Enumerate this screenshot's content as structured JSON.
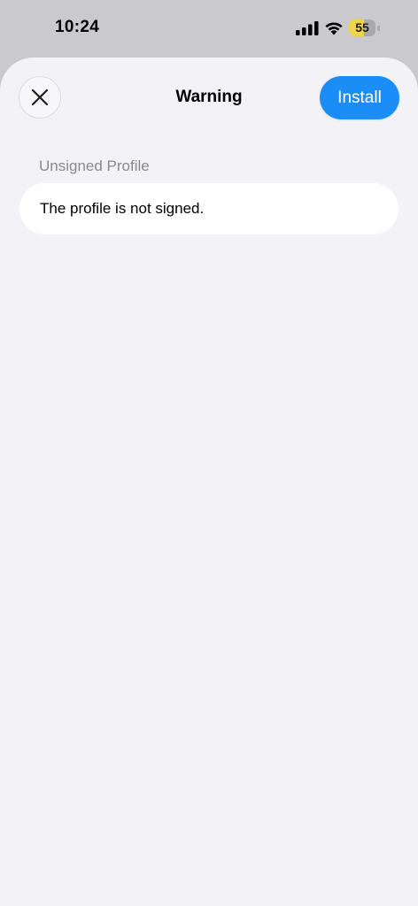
{
  "status_bar": {
    "time": "10:24",
    "battery_level": "55",
    "battery_fraction": 0.55,
    "icons": [
      "signal-icon",
      "wifi-icon",
      "battery-icon"
    ]
  },
  "sheet": {
    "title": "Warning",
    "install_label": "Install",
    "close_icon": "close-icon",
    "section": {
      "header": "Unsigned Profile",
      "message": "The profile is not signed."
    }
  },
  "colors": {
    "accent": "#1a8ef6",
    "background": "#f2f2f7",
    "battery": "#f0d44a",
    "section_header": "#8a8a8e"
  }
}
